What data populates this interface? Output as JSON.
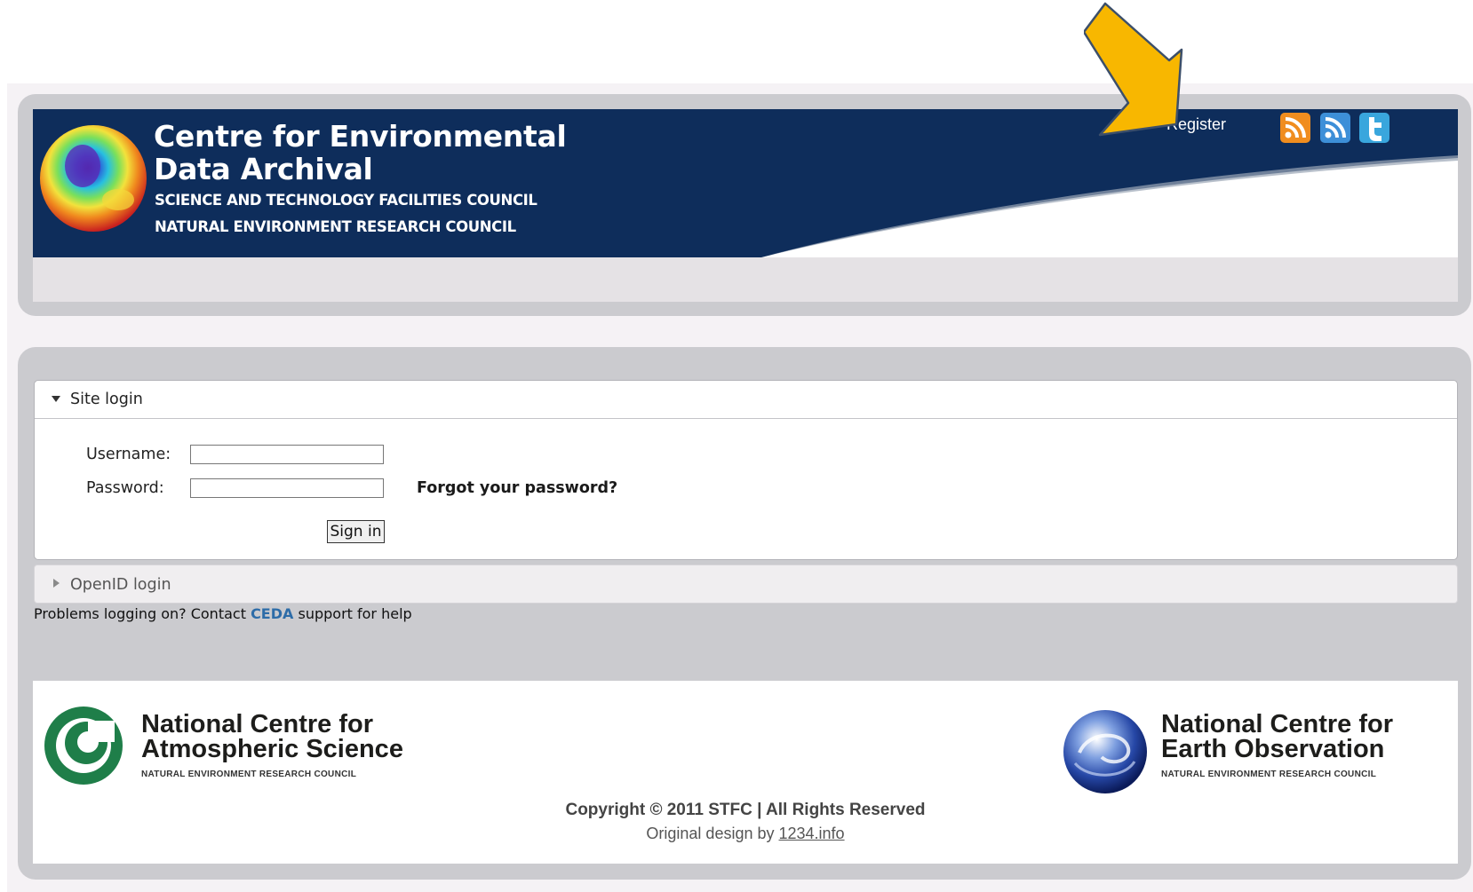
{
  "header": {
    "title": "Centre for Environmental Data Archival",
    "subtitle_1": "SCIENCE AND TECHNOLOGY FACILITIES COUNCIL",
    "subtitle_2": "NATURAL ENVIRONMENT RESEARCH COUNCIL",
    "register_label": "Register",
    "social_icons": [
      "rss-orange-icon",
      "rss-blue-icon",
      "twitter-icon"
    ]
  },
  "login": {
    "site_login_label": "Site login",
    "username_label": "Username:",
    "username_value": "",
    "password_label": "Password:",
    "password_value": "",
    "forgot_label": "Forgot your password?",
    "sign_in_label": "Sign in",
    "openid_label": "OpenID login",
    "help_prefix": "Problems logging on? Contact ",
    "help_link": "CEDA",
    "help_suffix": " support for help"
  },
  "footer": {
    "ncas_line1": "National Centre for",
    "ncas_line2": "Atmospheric Science",
    "ncas_council": "NATURAL ENVIRONMENT RESEARCH COUNCIL",
    "nceo_line1": "National Centre for",
    "nceo_line2": "Earth Observation",
    "nceo_council": "NATURAL ENVIRONMENT RESEARCH COUNCIL",
    "copyright": "Copyright © 2011  STFC  |  All Rights Reserved",
    "design_prefix": "Original design by ",
    "design_link": "1234.info"
  },
  "colors": {
    "banner_navy": "#0e2d5b",
    "panel_gray": "#cbcbcf",
    "arrow_yellow": "#f8b700",
    "link_blue": "#2d6ca8"
  }
}
